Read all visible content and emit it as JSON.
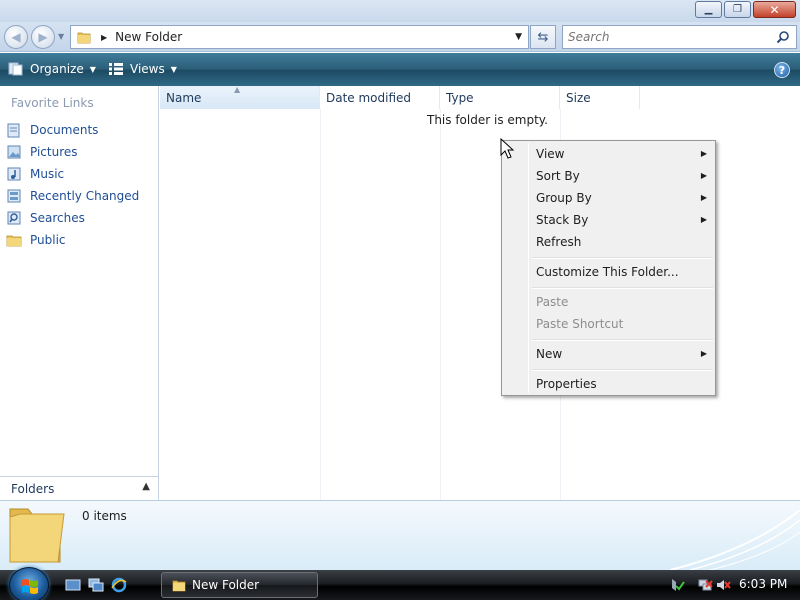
{
  "window": {
    "title": "New Folder",
    "buttons": {
      "minimize": "minimize",
      "maximize": "restore",
      "close": "close"
    }
  },
  "address": {
    "crumb": "New Folder",
    "search_placeholder": "Search"
  },
  "toolbar": {
    "organize_label": "Organize",
    "views_label": "Views",
    "help_label": "?"
  },
  "nav": {
    "favorites_heading": "Favorite Links",
    "items": [
      {
        "label": "Documents",
        "icon": "documents-icon"
      },
      {
        "label": "Pictures",
        "icon": "pictures-icon"
      },
      {
        "label": "Music",
        "icon": "music-icon"
      },
      {
        "label": "Recently Changed",
        "icon": "recently-changed-icon"
      },
      {
        "label": "Searches",
        "icon": "searches-icon"
      },
      {
        "label": "Public",
        "icon": "public-folder-icon"
      }
    ],
    "folders_label": "Folders"
  },
  "columns": {
    "name": "Name",
    "date_modified": "Date modified",
    "type": "Type",
    "size": "Size"
  },
  "content": {
    "empty_message": "This folder is empty."
  },
  "context_menu": {
    "items": [
      {
        "label": "View",
        "submenu": true,
        "enabled": true
      },
      {
        "label": "Sort By",
        "submenu": true,
        "enabled": true
      },
      {
        "label": "Group By",
        "submenu": true,
        "enabled": true
      },
      {
        "label": "Stack By",
        "submenu": true,
        "enabled": true
      },
      {
        "label": "Refresh",
        "submenu": false,
        "enabled": true
      },
      {
        "label": "Customize This Folder...",
        "submenu": false,
        "enabled": true
      },
      {
        "label": "Paste",
        "submenu": false,
        "enabled": false
      },
      {
        "label": "Paste Shortcut",
        "submenu": false,
        "enabled": false
      },
      {
        "label": "New",
        "submenu": true,
        "enabled": true
      },
      {
        "label": "Properties",
        "submenu": false,
        "enabled": true
      }
    ]
  },
  "details": {
    "item_count": "0 items"
  },
  "taskbar": {
    "task_label": "New Folder",
    "clock": "6:03 PM"
  },
  "colors": {
    "toolbar": "#2b5d78",
    "link": "#1f4e95",
    "disabled": "#8d8d8d"
  }
}
